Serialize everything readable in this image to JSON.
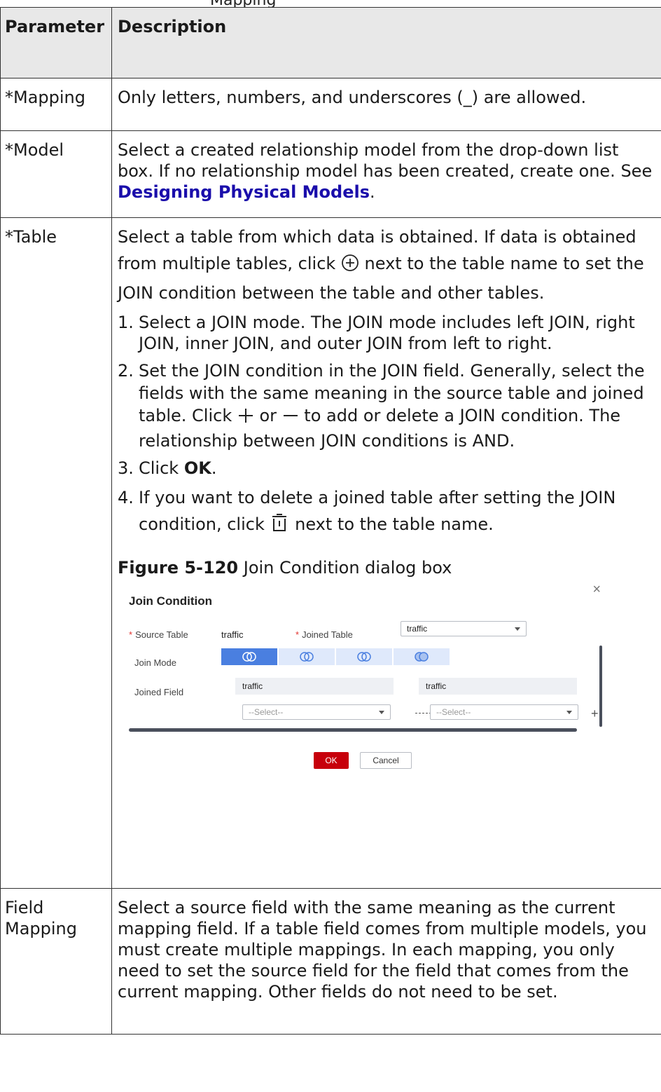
{
  "top_caption": "Mapping",
  "table": {
    "header": {
      "param": "Parameter",
      "desc": "Description"
    },
    "rows": {
      "mapping": {
        "param": "*Mapping",
        "desc": "Only letters, numbers, and underscores (_) are allowed."
      },
      "model": {
        "param": "*Model",
        "desc_before": "Select a created relationship model from the drop-down list box. If no relationship model has been created, create one. See ",
        "link": "Designing Physical Models",
        "desc_after": "."
      },
      "table": {
        "param": "*Table",
        "intro_before": "Select a table from which data is obtained. If data is obtained from multiple tables, click ",
        "intro_after": " next to the table name to set the JOIN condition between the table and other tables.",
        "steps": {
          "s1_num": "1.",
          "s1": "Select a JOIN mode. The JOIN mode includes left JOIN, right JOIN, inner JOIN, and outer JOIN from left to right.",
          "s2_num": "2.",
          "s2_before": "Set the JOIN condition in the JOIN field. Generally, select the fields with the same meaning in the source table and joined table. Click ",
          "s2_or": " or ",
          "s2_after": " to add or delete a JOIN condition. The relationship between JOIN conditions is AND.",
          "s3_num": "3.",
          "s3_before": "Click ",
          "s3_bold": "OK",
          "s3_after": ".",
          "s4_num": "4.",
          "s4_before": "If you want to delete a joined table after setting the JOIN condition, click ",
          "s4_after": " next to the table name."
        },
        "figure_label": "Figure 5-120",
        "figure_title": " Join Condition dialog box"
      },
      "field_mapping": {
        "param": "Field Mapping",
        "desc": "Select a source field with the same meaning as the current mapping field. If a table field comes from multiple models, you must create multiple mappings. In each mapping, you only need to set the source field for the field that comes from the current mapping. Other fields do not need to be set."
      }
    }
  },
  "dialog": {
    "title": "Join Condition",
    "close": "×",
    "source_table_label": "Source Table",
    "source_table_value": "traffic",
    "joined_table_label": "Joined Table",
    "joined_table_value": "traffic",
    "join_mode_label": "Join Mode",
    "joined_field_label": "Joined Field",
    "left_field_header": "traffic",
    "right_field_header": "traffic",
    "left_select_placeholder": "--Select--",
    "right_select_placeholder": "--Select--",
    "required_mark": "*",
    "ok_label": "OK",
    "cancel_label": "Cancel",
    "join_modes": [
      "left-join",
      "right-join",
      "inner-join",
      "outer-join"
    ],
    "active_mode": "left-join",
    "accent_color": "#4a7fe0",
    "ok_color": "#c7000b"
  },
  "icons": {
    "add_circle": "add-circle-icon",
    "plus": "plus-icon",
    "minus": "minus-icon",
    "delete": "trash-icon"
  }
}
